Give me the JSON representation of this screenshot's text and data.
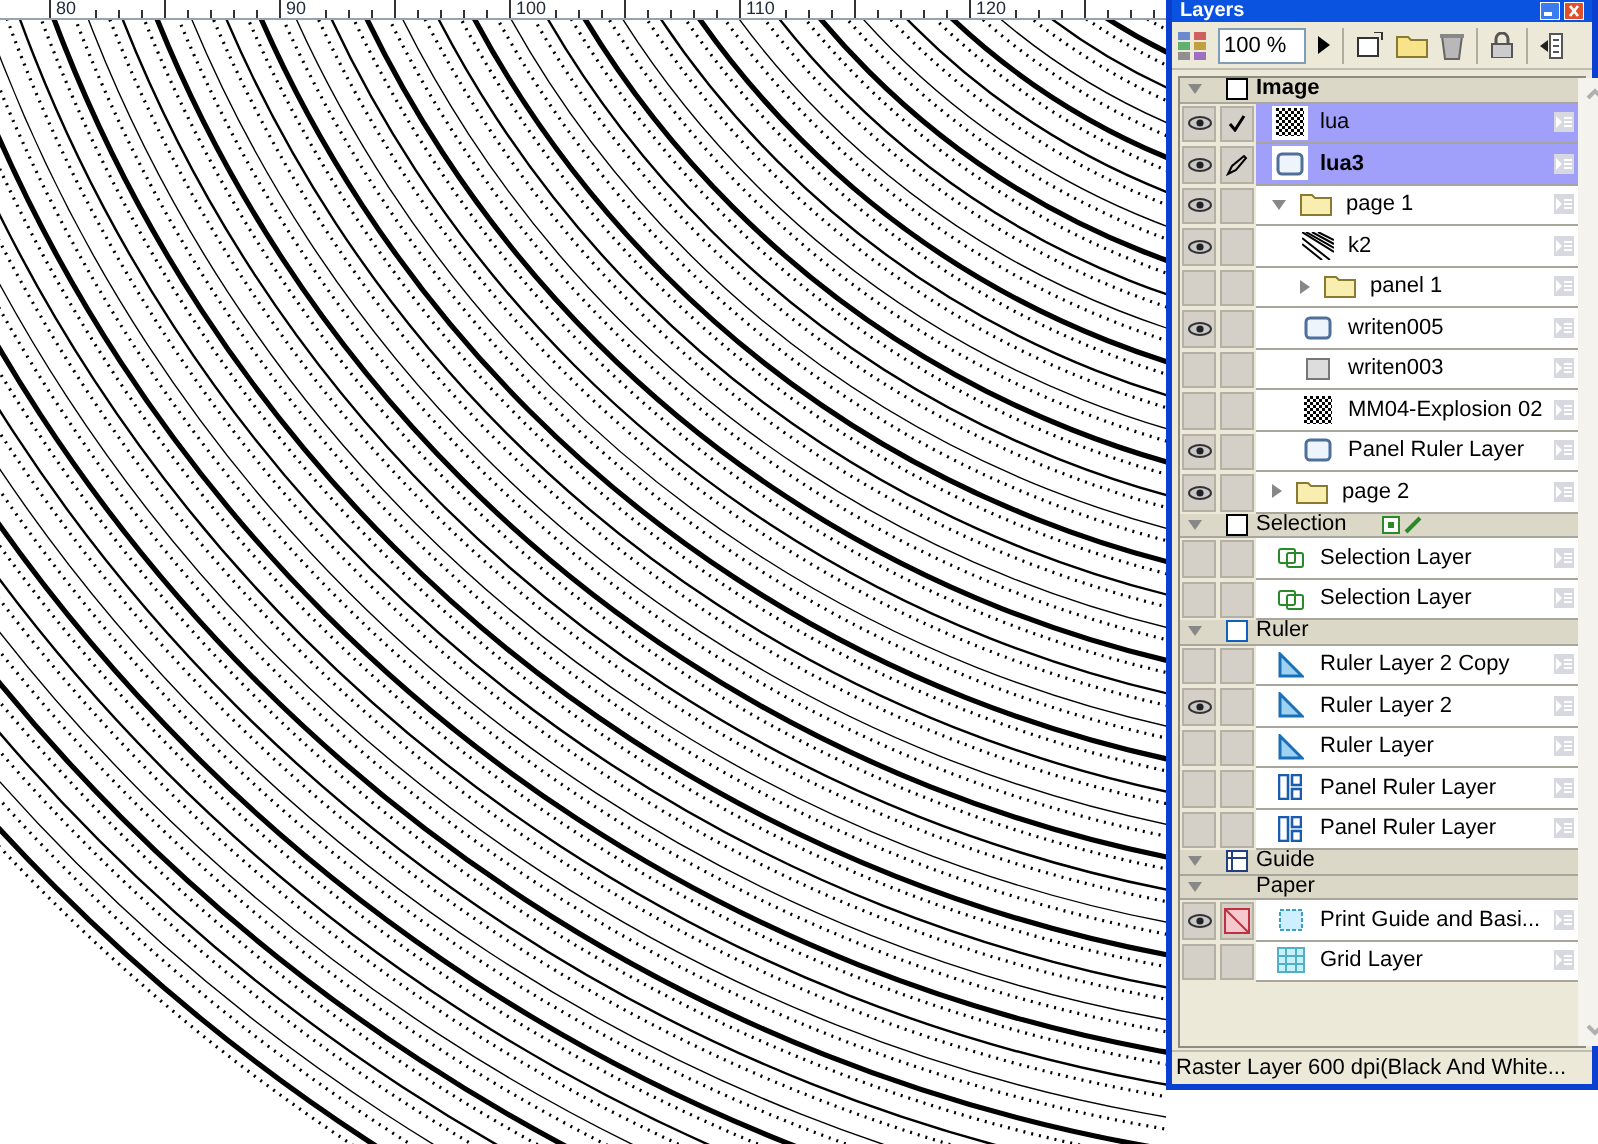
{
  "window": {
    "title": "Layers"
  },
  "ruler": {
    "labels": [
      "80",
      "90",
      "100",
      "110",
      "120"
    ]
  },
  "toolbar": {
    "zoom": "100 %"
  },
  "groups": [
    {
      "name": "Image",
      "kind": "image",
      "expanded": true,
      "layers": [
        {
          "name": "lua",
          "kind": "tone",
          "visible": true,
          "checked": true,
          "editing": false,
          "crossed": false,
          "selected": true,
          "active": false
        },
        {
          "name": "lua3",
          "kind": "vector",
          "visible": true,
          "checked": false,
          "editing": true,
          "crossed": false,
          "selected": true,
          "active": true
        },
        {
          "name": "page 1",
          "kind": "folder",
          "visible": true,
          "checked": false,
          "editing": false,
          "crossed": false,
          "selected": false,
          "active": false,
          "expanded": true,
          "children": [
            {
              "name": "k2",
              "kind": "lines",
              "visible": true,
              "checked": false,
              "editing": false,
              "crossed": false,
              "selected": false,
              "active": false
            },
            {
              "name": "panel 1",
              "kind": "folder",
              "visible": false,
              "checked": false,
              "editing": false,
              "crossed": false,
              "selected": false,
              "active": false,
              "expanded": false
            },
            {
              "name": "writen005",
              "kind": "vector",
              "visible": true,
              "checked": false,
              "editing": false,
              "crossed": false,
              "selected": false,
              "active": false
            },
            {
              "name": "writen003",
              "kind": "raster",
              "visible": false,
              "checked": false,
              "editing": false,
              "crossed": false,
              "selected": false,
              "active": false
            },
            {
              "name": "MM04-Explosion 02",
              "kind": "tone",
              "visible": false,
              "checked": false,
              "editing": false,
              "crossed": false,
              "selected": false,
              "active": false
            },
            {
              "name": "Panel Ruler Layer",
              "kind": "vector",
              "visible": true,
              "checked": false,
              "editing": false,
              "crossed": false,
              "selected": false,
              "active": false
            }
          ]
        },
        {
          "name": "page 2",
          "kind": "folder",
          "visible": true,
          "checked": false,
          "editing": false,
          "crossed": false,
          "selected": false,
          "active": false,
          "expanded": false
        }
      ]
    },
    {
      "name": "Selection",
      "kind": "selection",
      "expanded": true,
      "layers": [
        {
          "name": "Selection Layer",
          "kind": "selection",
          "visible": false,
          "checked": false,
          "editing": false,
          "crossed": false,
          "selected": false,
          "active": false
        },
        {
          "name": "Selection Layer",
          "kind": "selection",
          "visible": false,
          "checked": false,
          "editing": false,
          "crossed": false,
          "selected": false,
          "active": false
        }
      ]
    },
    {
      "name": "Ruler",
      "kind": "ruler",
      "expanded": true,
      "layers": [
        {
          "name": "Ruler Layer 2 Copy",
          "kind": "ruler",
          "visible": false,
          "checked": false,
          "editing": false,
          "crossed": false,
          "selected": false,
          "active": false
        },
        {
          "name": "Ruler Layer 2",
          "kind": "ruler",
          "visible": true,
          "checked": false,
          "editing": false,
          "crossed": false,
          "selected": false,
          "active": false
        },
        {
          "name": "Ruler Layer",
          "kind": "ruler",
          "visible": false,
          "checked": false,
          "editing": false,
          "crossed": false,
          "selected": false,
          "active": false
        },
        {
          "name": "Panel Ruler Layer",
          "kind": "panel-ruler",
          "visible": false,
          "checked": false,
          "editing": false,
          "crossed": false,
          "selected": false,
          "active": false
        },
        {
          "name": "Panel Ruler Layer",
          "kind": "panel-ruler",
          "visible": false,
          "checked": false,
          "editing": false,
          "crossed": false,
          "selected": false,
          "active": false
        }
      ]
    },
    {
      "name": "Guide",
      "kind": "guide",
      "expanded": true
    },
    {
      "name": "Paper",
      "kind": "paper",
      "expanded": true,
      "layers": [
        {
          "name": "Print Guide and Basi...",
          "kind": "print-guide",
          "visible": true,
          "checked": false,
          "editing": false,
          "crossed": true,
          "selected": false,
          "active": false
        },
        {
          "name": "Grid Layer",
          "kind": "grid",
          "visible": false,
          "checked": false,
          "editing": false,
          "crossed": false,
          "selected": false,
          "active": false
        }
      ]
    }
  ],
  "status_bar": "Raster Layer 600 dpi(Black And White..."
}
